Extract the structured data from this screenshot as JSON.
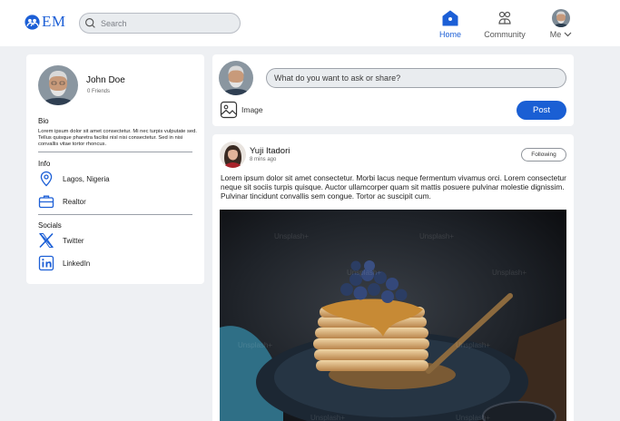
{
  "header": {
    "logo_text": "EM",
    "search_placeholder": "Search",
    "nav": {
      "home": "Home",
      "community": "Community",
      "me": "Me"
    }
  },
  "profile": {
    "name": "John Doe",
    "friends": "0 Friends",
    "bio_title": "Bio",
    "bio_text": "Lorem ipsum dolor sit amet consectetur. Mi nec turpis vulputate sed. Tellus quisque pharetra facilisi nisl nisi consectetur. Sed in nisi convallis vitae tortor rhoncus.",
    "info_title": "Info",
    "location": "Lagos, Nigeria",
    "occupation": "Realtor",
    "socials_title": "Socials",
    "twitter": "Twitter",
    "linkedin": "LinkedIn"
  },
  "composer": {
    "placeholder": "What do you want to ask or share?",
    "image_label": "Image",
    "post_label": "Post"
  },
  "post": {
    "author": "Yuji Itadori",
    "time": "8 mins ago",
    "follow_label": "Following",
    "text": "Lorem ipsum dolor sit amet consectetur. Morbi lacus neque fermentum vivamus orci. Lorem consectetur neque sit sociis turpis quisque. Auctor ullamcorper quam sit mattis posuere pulvinar molestie dignissim. Pulvinar tincidunt convallis sem congue. Tortor ac suscipit cum.",
    "image_watermark": "Unsplash+"
  },
  "colors": {
    "accent": "#1a5fd4",
    "background": "#eef0f3"
  },
  "icons": {
    "logo": "people-logo-icon",
    "search": "search-icon",
    "home": "home-icon",
    "community": "community-icon",
    "location": "location-pin-icon",
    "job": "briefcase-icon",
    "twitter": "x-twitter-icon",
    "linkedin": "linkedin-icon",
    "image": "image-icon",
    "chevron": "chevron-down-icon"
  }
}
